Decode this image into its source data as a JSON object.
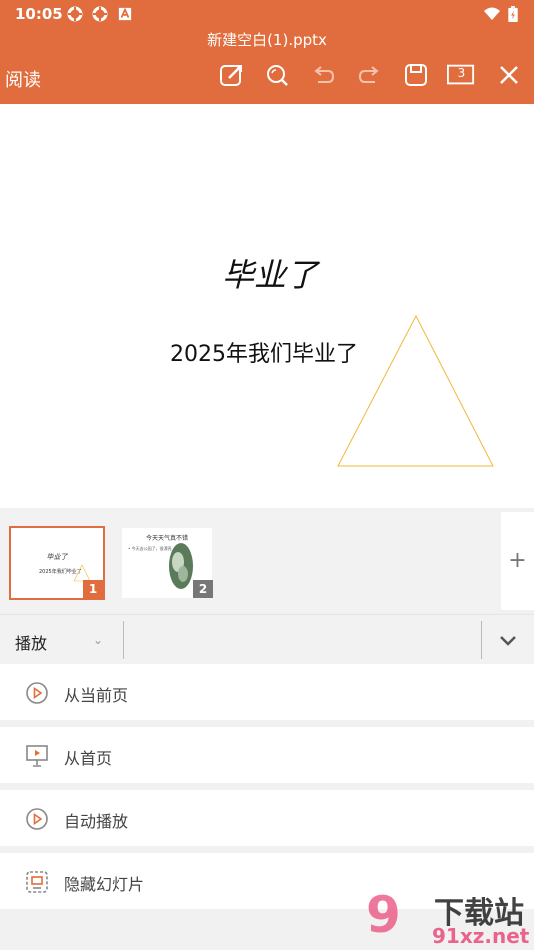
{
  "status_bar": {
    "time": "10:05"
  },
  "header": {
    "doc_title": "新建空白(1).pptx",
    "read_label": "阅读",
    "page_count": "3",
    "accent_color": "#e16d3e"
  },
  "toolbar_icons": [
    "edit-icon",
    "search-icon",
    "undo-icon",
    "redo-icon",
    "save-icon",
    "page-count-icon",
    "close-icon"
  ],
  "slide": {
    "title": "毕业了",
    "subtitle": "2025年我们毕业了"
  },
  "thumbnails": [
    {
      "number": "1",
      "title": "毕业了",
      "subtitle": "2025年我们毕业了"
    },
    {
      "number": "2",
      "title": "今天天气真不错",
      "bullet": "• 今天去公园了，很漂亮"
    }
  ],
  "add_slide": "+",
  "tabbar": {
    "selected": "播放"
  },
  "menu": [
    {
      "label": "从当前页",
      "icon": "play-circle-icon"
    },
    {
      "label": "从首页",
      "icon": "projector-icon"
    },
    {
      "label": "自动播放",
      "icon": "play-circle-icon"
    },
    {
      "label": "隐藏幻灯片",
      "icon": "hidden-slide-icon"
    }
  ],
  "watermark": {
    "text": "下载站",
    "url_text": "91xz.net",
    "logo": "9"
  }
}
